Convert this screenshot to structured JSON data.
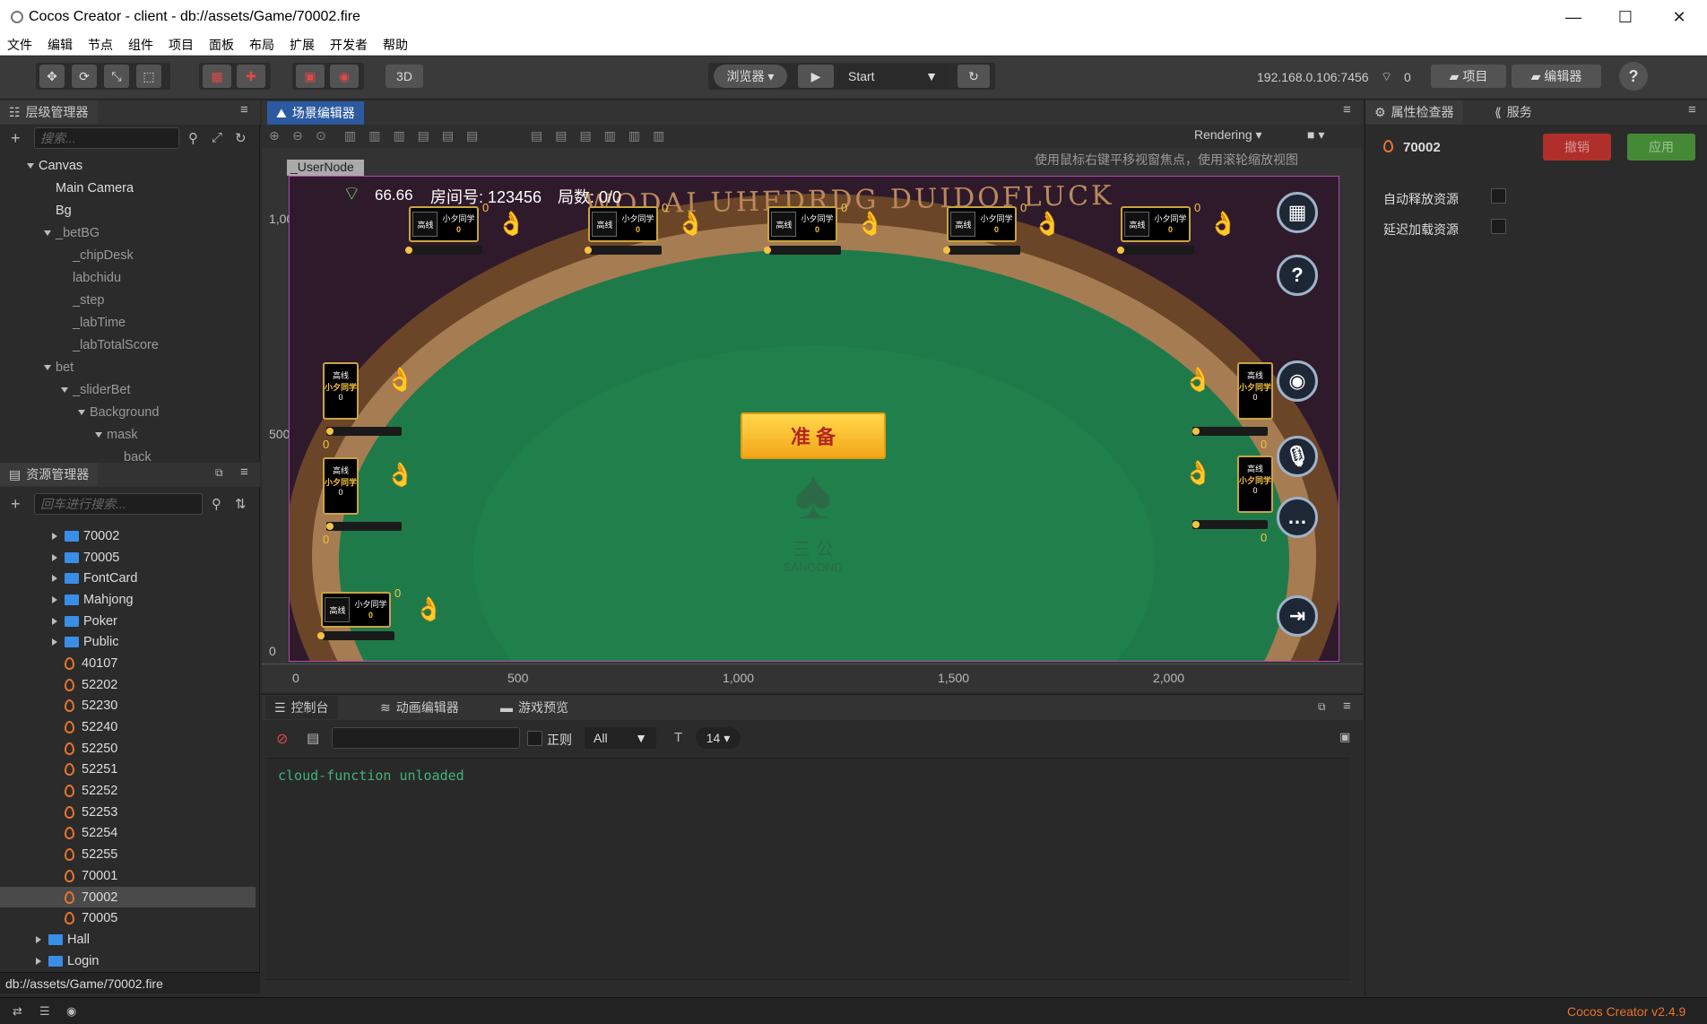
{
  "window": {
    "title": "Cocos Creator - client - db://assets/Game/70002.fire",
    "minimize": "—",
    "maximize": "☐",
    "close": "✕"
  },
  "menu": [
    "文件",
    "编辑",
    "节点",
    "组件",
    "项目",
    "面板",
    "布局",
    "扩展",
    "开发者",
    "帮助"
  ],
  "toolbar": {
    "mode3d": "3D",
    "browser": "浏览器 ▾",
    "start": "Start",
    "ip": "192.168.0.106:7456",
    "count": "0",
    "project_btn": "项目",
    "editor_btn": "编辑器",
    "help": "?"
  },
  "hierarchy": {
    "tab": "层级管理器",
    "search_placeholder": "搜索...",
    "nodes": [
      {
        "label": "Canvas",
        "indent": 0,
        "arrow": "down",
        "gray": false
      },
      {
        "label": "Main Camera",
        "indent": 1,
        "arrow": "",
        "gray": false
      },
      {
        "label": "Bg",
        "indent": 1,
        "arrow": "",
        "gray": false
      },
      {
        "label": "_betBG",
        "indent": 1,
        "arrow": "down",
        "gray": true
      },
      {
        "label": "_chipDesk",
        "indent": 2,
        "arrow": "",
        "gray": true
      },
      {
        "label": "labchidu",
        "indent": 2,
        "arrow": "",
        "gray": true
      },
      {
        "label": "_step",
        "indent": 2,
        "arrow": "",
        "gray": true
      },
      {
        "label": "_labTime",
        "indent": 2,
        "arrow": "",
        "gray": true
      },
      {
        "label": "_labTotalScore",
        "indent": 2,
        "arrow": "",
        "gray": true
      },
      {
        "label": "bet",
        "indent": 1,
        "arrow": "down",
        "gray": true
      },
      {
        "label": "_sliderBet",
        "indent": 2,
        "arrow": "down",
        "gray": true
      },
      {
        "label": "Background",
        "indent": 3,
        "arrow": "down",
        "gray": true
      },
      {
        "label": "mask",
        "indent": 4,
        "arrow": "down",
        "gray": true
      },
      {
        "label": "back",
        "indent": 5,
        "arrow": "",
        "gray": true
      }
    ]
  },
  "assets": {
    "tab": "资源管理器",
    "search_placeholder": "回车进行搜索...",
    "items": [
      {
        "label": "70002",
        "type": "folder",
        "indent": 1
      },
      {
        "label": "70005",
        "type": "folder",
        "indent": 1
      },
      {
        "label": "FontCard",
        "type": "folder",
        "indent": 1
      },
      {
        "label": "Mahjong",
        "type": "folder",
        "indent": 1
      },
      {
        "label": "Poker",
        "type": "folder",
        "indent": 1
      },
      {
        "label": "Public",
        "type": "folder",
        "indent": 1
      },
      {
        "label": "40107",
        "type": "fire",
        "indent": 1
      },
      {
        "label": "52202",
        "type": "fire",
        "indent": 1
      },
      {
        "label": "52230",
        "type": "fire",
        "indent": 1
      },
      {
        "label": "52240",
        "type": "fire",
        "indent": 1
      },
      {
        "label": "52250",
        "type": "fire",
        "indent": 1
      },
      {
        "label": "52251",
        "type": "fire",
        "indent": 1
      },
      {
        "label": "52252",
        "type": "fire",
        "indent": 1
      },
      {
        "label": "52253",
        "type": "fire",
        "indent": 1
      },
      {
        "label": "52254",
        "type": "fire",
        "indent": 1
      },
      {
        "label": "52255",
        "type": "fire",
        "indent": 1
      },
      {
        "label": "70001",
        "type": "fire",
        "indent": 1
      },
      {
        "label": "70002",
        "type": "fire",
        "indent": 1,
        "selected": true
      },
      {
        "label": "70005",
        "type": "fire",
        "indent": 1
      },
      {
        "label": "Hall",
        "type": "folder",
        "indent": 0
      },
      {
        "label": "Login",
        "type": "folder",
        "indent": 0
      }
    ],
    "path": "db://assets/Game/70002.fire"
  },
  "scene_editor": {
    "tab": "场景编辑器",
    "rendering": "Rendering",
    "hint": "使用鼠标右键平移视窗焦点，使用滚轮缩放视图",
    "node_label": "_UserNode",
    "ruler_left": [
      "1,000",
      "500",
      "0"
    ],
    "ruler_bottom": [
      "0",
      "500",
      "1,000",
      "1,500",
      "2,000"
    ]
  },
  "game": {
    "signal": "66.66",
    "room": "房间号: 123456",
    "rounds": "局数: 0/0",
    "ready": "准 备",
    "table_text": "WODAI UHFDRDG DUIDOFLUCK",
    "logo_text": "三   公",
    "logo_sub": "SANGONG",
    "seat_avatar": "高线",
    "seat_name": "小夕同学",
    "seat_score": "0"
  },
  "console": {
    "tabs": [
      "控制台",
      "动画编辑器",
      "游戏预览"
    ],
    "regex": "正则",
    "level": "All",
    "fontsize": "14",
    "log": "cloud-function unloaded"
  },
  "inspector": {
    "tabs": [
      "属性检查器",
      "服务"
    ],
    "asset_name": "70002",
    "revert": "撤销",
    "apply": "应用",
    "auto_release": "自动释放资源",
    "async_load": "延迟加载资源"
  },
  "status": {
    "version": "Cocos Creator v2.4.9"
  },
  "colors": {
    "accent": "#2c5aa0",
    "revert": "#c9302c",
    "apply": "#4a9a3a",
    "felt": "#1f7a4a",
    "gold": "#f5c242",
    "console_text": "#3fb37f"
  }
}
